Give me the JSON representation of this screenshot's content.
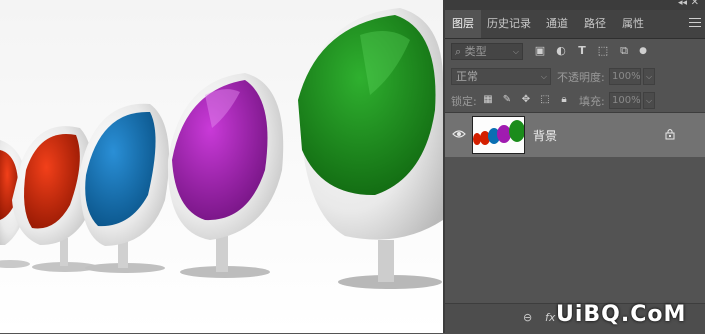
{
  "panel": {
    "tabs": [
      {
        "label": "图层",
        "active": true
      },
      {
        "label": "历史记录",
        "active": false
      },
      {
        "label": "通道",
        "active": false
      },
      {
        "label": "路径",
        "active": false
      },
      {
        "label": "属性",
        "active": false
      }
    ],
    "filter": {
      "kind_placeholder": "类型"
    },
    "blend": {
      "mode": "正常",
      "opacity_label": "不透明度:",
      "opacity_value": "100%"
    },
    "lock": {
      "label": "锁定:",
      "fill_label": "填充:",
      "fill_value": "100%"
    },
    "layers": [
      {
        "name": "背景",
        "visible": true,
        "locked": true,
        "selected": true
      }
    ]
  },
  "watermark": "UiBQ.CoM",
  "colors": {
    "panel_bg": "#535353",
    "selected_layer": "#727272",
    "chair_red": "#d41f00",
    "chair_blue": "#0a6fb3",
    "chair_purple": "#a01bb0",
    "chair_green": "#1b8c1b"
  },
  "icons": [
    "search-icon",
    "image-filter-icon",
    "adjustment-filter-icon",
    "type-filter-icon",
    "shape-filter-icon",
    "smart-object-filter-icon",
    "filter-toggle-icon",
    "lock-pixels-icon",
    "lock-paint-icon",
    "lock-position-icon",
    "lock-artboard-icon",
    "lock-all-icon",
    "eye-icon",
    "lock-icon",
    "link-icon",
    "fx-icon"
  ]
}
